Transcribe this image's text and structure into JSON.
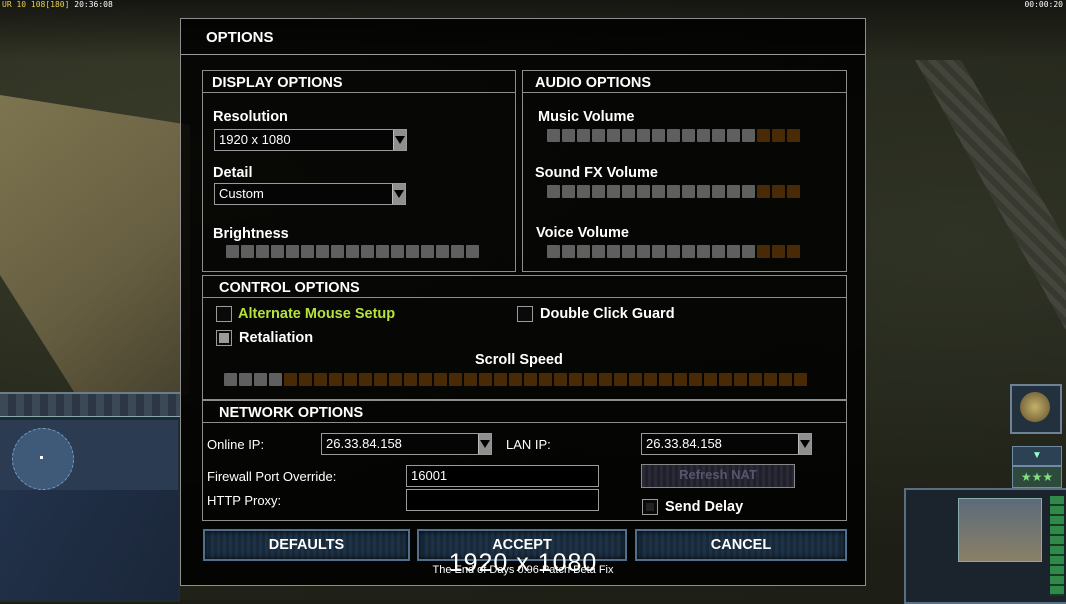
{
  "hud": {
    "left_text": "UR 10 108",
    "left_bracket": "[180]",
    "left_time": "20:36:08",
    "right_time": "00:00:20"
  },
  "dialog": {
    "title": "OPTIONS",
    "display": {
      "header": "DISPLAY OPTIONS",
      "resolution_label": "Resolution",
      "resolution_value": "1920 x 1080",
      "detail_label": "Detail",
      "detail_value": "Custom",
      "brightness_label": "Brightness",
      "brightness_level": 1.0
    },
    "audio": {
      "header": "AUDIO OPTIONS",
      "music_label": "Music Volume",
      "music_level": 0.8,
      "sfx_label": "Sound FX Volume",
      "sfx_level": 0.8,
      "voice_label": "Voice Volume",
      "voice_level": 0.8
    },
    "control": {
      "header": "CONTROL OPTIONS",
      "alt_mouse_label": "Alternate Mouse Setup",
      "alt_mouse_checked": false,
      "double_click_label": "Double Click Guard",
      "double_click_checked": false,
      "retaliation_label": "Retaliation",
      "retaliation_checked": true,
      "scroll_label": "Scroll Speed",
      "scroll_level": 0.1
    },
    "network": {
      "header": "NETWORK OPTIONS",
      "online_ip_label": "Online IP:",
      "online_ip_value": "26.33.84.158",
      "lan_ip_label": "LAN IP:",
      "lan_ip_value": "26.33.84.158",
      "firewall_label": "Firewall Port Override:",
      "firewall_value": "16001",
      "http_proxy_label": "HTTP Proxy:",
      "http_proxy_value": "",
      "refresh_nat_label": "Refresh NAT",
      "send_delay_label": "Send Delay",
      "send_delay_checked": false
    },
    "buttons": {
      "defaults": "DEFAULTS",
      "accept": "ACCEPT",
      "cancel": "CANCEL"
    },
    "footer": "The End of Days 0.96 Patch Beta Fix",
    "overlay_resolution": "1920 x 1080"
  },
  "colors": {
    "accent_green": "#b6e33b",
    "slider_on": "#5f5f5f",
    "slider_off": "#4a2a05",
    "button_blue": "#1e3246"
  },
  "icons": {
    "rank": "rank-emblem-icon",
    "collapse": "down-arrow-icon",
    "stars": "three-stars-icon"
  }
}
